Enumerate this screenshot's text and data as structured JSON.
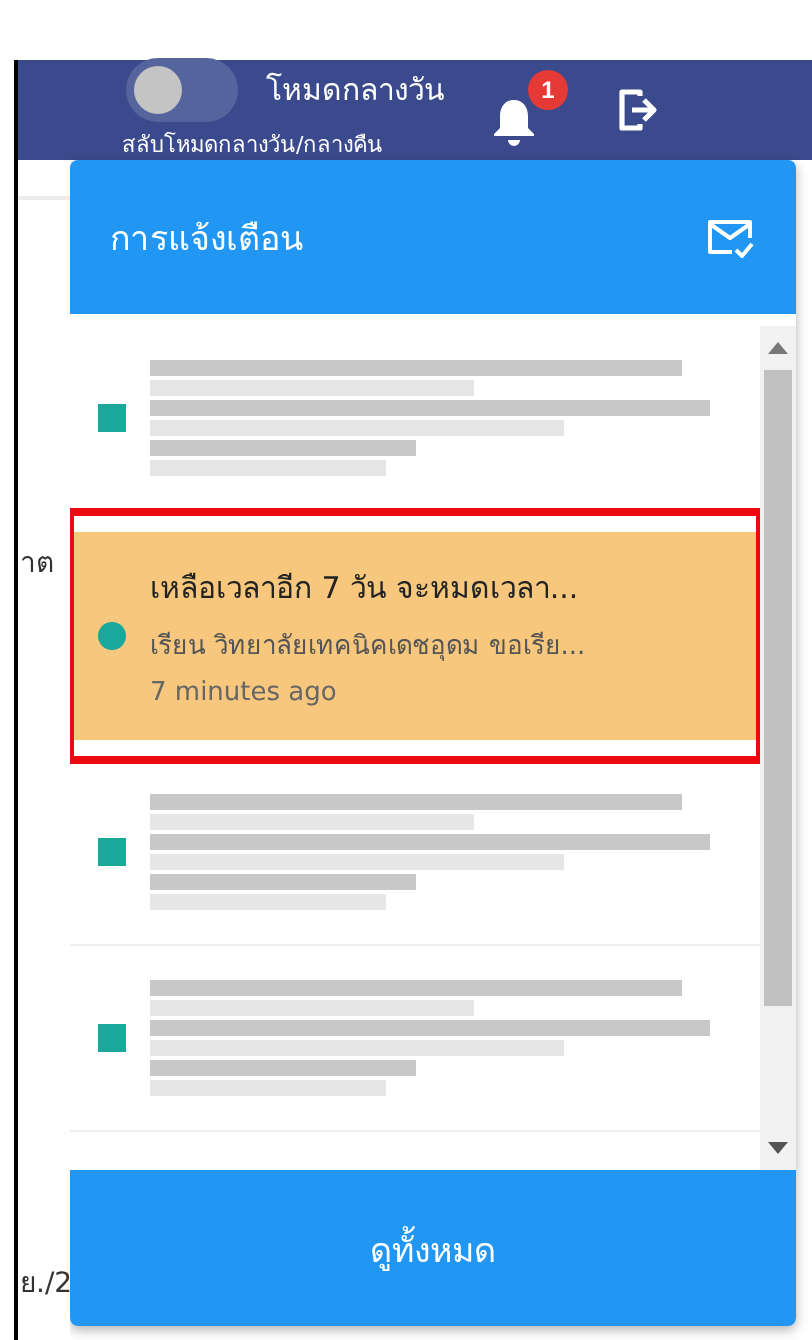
{
  "topbar": {
    "theme_toggle": {
      "on": false,
      "label": "โหมดกลางวัน",
      "caption": "สลับโหมดกลางวัน/กลางคืน"
    },
    "notification_count": "1"
  },
  "background_fragments": [
    "าต",
    "ย./2"
  ],
  "notifications": {
    "title": "การแจ้งเตือน",
    "items": [
      {
        "kind": "redacted",
        "color": "#1aa89a",
        "highlighted": false
      },
      {
        "kind": "text",
        "title": "เหลือเวลาอีก 7 วัน จะหมดเวลา...",
        "body": "เรียน วิทยาลัยเทคนิคเดชอุดม ขอเรีย...",
        "time": "7 minutes ago",
        "color": "#1aa89a",
        "highlighted": true
      },
      {
        "kind": "redacted",
        "color": "#1aa89a",
        "highlighted": false
      },
      {
        "kind": "redacted",
        "color": "#1aa89a",
        "highlighted": false
      }
    ],
    "footer_button": "ดูทั้งหมด"
  }
}
